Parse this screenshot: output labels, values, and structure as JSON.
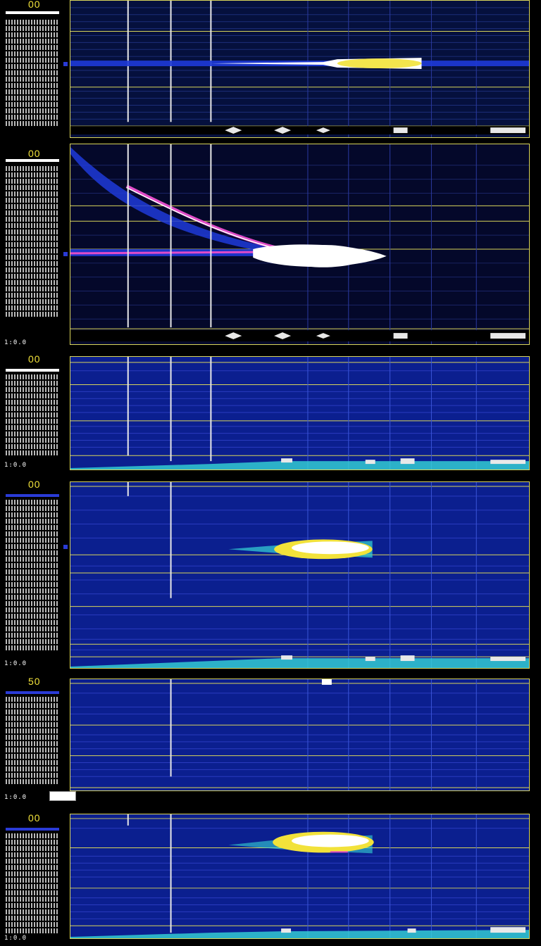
{
  "panels": [
    {
      "id": "panel-1",
      "count_label": "00",
      "mini_label": ""
    },
    {
      "id": "panel-2",
      "count_label": "00",
      "mini_label": "1:0.0"
    },
    {
      "id": "panel-3",
      "count_label": "00",
      "mini_label": "1:0.0"
    },
    {
      "id": "panel-4",
      "count_label": "00",
      "mini_label": "1:0.0"
    },
    {
      "id": "panel-5",
      "count_label": "50",
      "mini_label": "1:0.0"
    },
    {
      "id": "panel-6",
      "count_label": "00",
      "mini_label": "1:0.0"
    }
  ],
  "colors": {
    "background": "#000000",
    "grid_line": "#d9d55a",
    "plot_dark": "#05103d",
    "plot_blue": "#0b1f8f",
    "signal_white": "#ffffff",
    "signal_yellow": "#f2e23a",
    "signal_magenta": "#e04cc8",
    "signal_cyan": "#35d6d6"
  }
}
